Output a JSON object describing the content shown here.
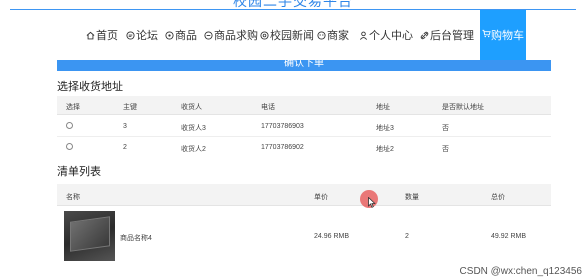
{
  "site": {
    "title": "校园二手交易平台"
  },
  "nav": {
    "items": [
      {
        "label": "首页",
        "icon": "home-icon"
      },
      {
        "label": "论坛",
        "icon": "forum-icon"
      },
      {
        "label": "商品",
        "icon": "goods-icon"
      },
      {
        "label": "商品求购",
        "icon": "request-icon"
      },
      {
        "label": "校园新闻",
        "icon": "news-icon"
      },
      {
        "label": "商家",
        "icon": "shop-icon"
      },
      {
        "label": "个人中心",
        "icon": "user-icon"
      },
      {
        "label": "后台管理",
        "icon": "link-icon"
      }
    ],
    "cart": {
      "label": "购物车",
      "icon": "cart-icon"
    },
    "accent_color": "#1e9fff"
  },
  "submit": {
    "label": "确认下单"
  },
  "address_section": {
    "title": "选择收货地址",
    "columns": [
      "选择",
      "主键",
      "收货人",
      "电话",
      "地址",
      "是否默认地址"
    ],
    "rows": [
      {
        "id": "3",
        "name": "收货人3",
        "phone": "17703786903",
        "address": "地址3",
        "is_default": "否"
      },
      {
        "id": "2",
        "name": "收货人2",
        "phone": "17703786902",
        "address": "地址2",
        "is_default": "否"
      }
    ]
  },
  "order_section": {
    "title": "清单列表",
    "columns": [
      "名称",
      "单价",
      "数量",
      "总价"
    ],
    "rows": [
      {
        "name": "商品名称4",
        "price": "24.96 RMB",
        "quantity": "2",
        "total": "49.92 RMB"
      }
    ]
  },
  "watermark": "CSDN @wx:chen_q123456"
}
